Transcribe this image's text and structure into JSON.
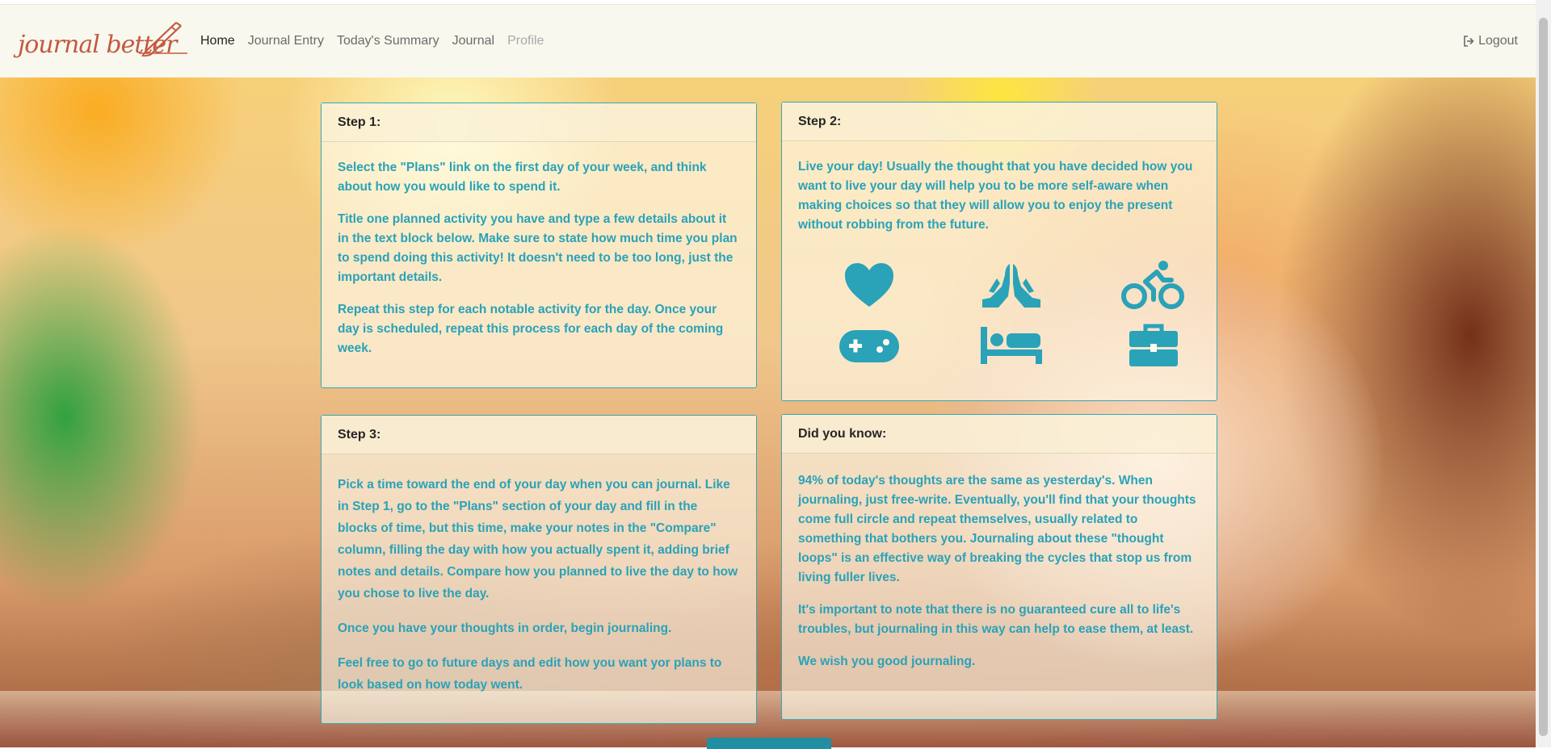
{
  "brand": {
    "name": "journal better"
  },
  "nav": {
    "items": [
      {
        "label": "Home",
        "state": "active"
      },
      {
        "label": "Journal Entry",
        "state": "normal"
      },
      {
        "label": "Today's Summary",
        "state": "normal"
      },
      {
        "label": "Journal",
        "state": "normal"
      },
      {
        "label": "Profile",
        "state": "disabled"
      }
    ],
    "logout_label": "Logout",
    "logout_icon": "sign-out-icon"
  },
  "cards": {
    "step1": {
      "title": "Step 1:",
      "paragraphs": [
        "Select the \"Plans\" link on the first day of your week, and think about how you would like to spend it.",
        "Title one planned activity you have and type a few details about it in the text block below. Make sure to state how much time you plan to spend doing this activity! It doesn't need to be too long, just the important details.",
        "Repeat this step for each notable activity for the day. Once your day is scheduled, repeat this process for each day of the coming week."
      ]
    },
    "step2": {
      "title": "Step 2:",
      "paragraphs": [
        "Live your day! Usually the thought that you have decided how you want to live your day will help you to be more self-aware when making choices so that they will allow you to enjoy the present without robbing from the future."
      ],
      "icons": [
        "heart-icon",
        "praying-hands-icon",
        "biking-icon",
        "gamepad-icon",
        "bed-icon",
        "briefcase-icon"
      ]
    },
    "step3": {
      "title": "Step 3:",
      "paragraphs": [
        "Pick a time toward the end of your day when you can journal. Like in Step 1, go to the \"Plans\" section of your day and fill in the blocks of time, but this time, make your notes in the \"Compare\" column, filling the day with how you actually spent it, adding brief notes and details. Compare how you planned to live the day to how you chose to live the day.",
        "Once you have your thoughts in order, begin journaling.",
        "Feel free to go to future days and edit how you want yor plans to look based on how today went."
      ]
    },
    "didyouknow": {
      "title": "Did you know:",
      "paragraphs": [
        "94% of today's thoughts are the same as yesterday's. When journaling, just free-write. Eventually, you'll find that your thoughts come full circle and repeat themselves, usually related to something that bothers you. Journaling about these \"thought loops\" is an effective way of breaking the cycles that stop us from living fuller lives.",
        "It's important to note that there is no guaranteed cure all to life's troubles, but journaling in this way can help to ease them, at least.",
        "We wish you good journaling."
      ]
    }
  },
  "colors": {
    "accent": "#2aa2b8",
    "brand": "#c4593f",
    "navbar_bg": "#f8f8ef"
  }
}
